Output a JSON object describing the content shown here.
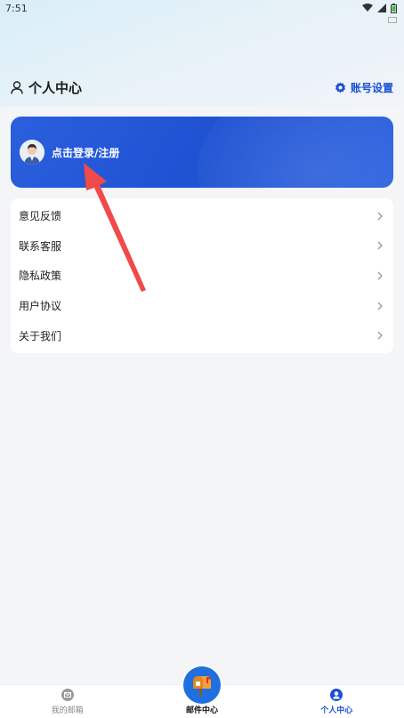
{
  "status_bar": {
    "time": "7:51"
  },
  "header": {
    "title": "个人中心",
    "settings_label": "账号设置"
  },
  "login_card": {
    "text": "点击登录/注册"
  },
  "menu": {
    "items": [
      {
        "label": "意见反馈"
      },
      {
        "label": "联系客服"
      },
      {
        "label": "隐私政策"
      },
      {
        "label": "用户协议"
      },
      {
        "label": "关于我们"
      }
    ]
  },
  "tabbar": {
    "tabs": [
      {
        "label": "我的邮箱"
      },
      {
        "label": "邮件中心"
      },
      {
        "label": "个人中心"
      }
    ]
  },
  "colors": {
    "accent": "#1b4fd6",
    "annotation_arrow": "#f04a4a"
  }
}
